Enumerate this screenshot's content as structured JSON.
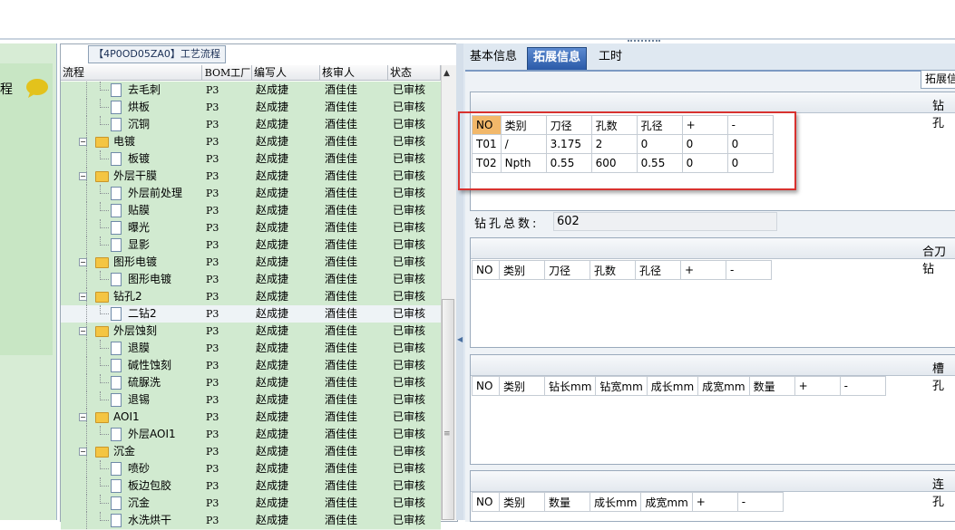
{
  "left_sidebar": {
    "partial_label": "程"
  },
  "process_panel": {
    "title": "【4P0OD05ZA0】工艺流程",
    "columns": [
      "流程",
      "BOM工厂",
      "编写人",
      "核审人",
      "状态"
    ],
    "rows": [
      {
        "name": "去毛刺",
        "type": "step",
        "bom": "P3",
        "writer": "赵成捷",
        "reviewer": "酒佳佳",
        "status": "已审核"
      },
      {
        "name": "烘板",
        "type": "step",
        "bom": "P3",
        "writer": "赵成捷",
        "reviewer": "酒佳佳",
        "status": "已审核"
      },
      {
        "name": "沉铜",
        "type": "step",
        "bom": "P3",
        "writer": "赵成捷",
        "reviewer": "酒佳佳",
        "status": "已审核"
      },
      {
        "name": "电镀",
        "type": "group",
        "bom": "P3",
        "writer": "赵成捷",
        "reviewer": "酒佳佳",
        "status": "已审核"
      },
      {
        "name": "板镀",
        "type": "step",
        "bom": "P3",
        "writer": "赵成捷",
        "reviewer": "酒佳佳",
        "status": "已审核"
      },
      {
        "name": "外层干膜",
        "type": "group",
        "bom": "P3",
        "writer": "赵成捷",
        "reviewer": "酒佳佳",
        "status": "已审核"
      },
      {
        "name": "外层前处理",
        "type": "step",
        "bom": "P3",
        "writer": "赵成捷",
        "reviewer": "酒佳佳",
        "status": "已审核"
      },
      {
        "name": "贴膜",
        "type": "step",
        "bom": "P3",
        "writer": "赵成捷",
        "reviewer": "酒佳佳",
        "status": "已审核"
      },
      {
        "name": "曝光",
        "type": "step",
        "bom": "P3",
        "writer": "赵成捷",
        "reviewer": "酒佳佳",
        "status": "已审核"
      },
      {
        "name": "显影",
        "type": "step",
        "bom": "P3",
        "writer": "赵成捷",
        "reviewer": "酒佳佳",
        "status": "已审核"
      },
      {
        "name": "图形电镀",
        "type": "group",
        "bom": "P3",
        "writer": "赵成捷",
        "reviewer": "酒佳佳",
        "status": "已审核"
      },
      {
        "name": "图形电镀",
        "type": "step",
        "bom": "P3",
        "writer": "赵成捷",
        "reviewer": "酒佳佳",
        "status": "已审核"
      },
      {
        "name": "钻孔2",
        "type": "group",
        "bom": "P3",
        "writer": "赵成捷",
        "reviewer": "酒佳佳",
        "status": "已审核"
      },
      {
        "name": "二钻2",
        "type": "step",
        "bom": "P3",
        "writer": "赵成捷",
        "reviewer": "酒佳佳",
        "status": "已审核",
        "selected": true
      },
      {
        "name": "外层蚀刻",
        "type": "group",
        "bom": "P3",
        "writer": "赵成捷",
        "reviewer": "酒佳佳",
        "status": "已审核"
      },
      {
        "name": "退膜",
        "type": "step",
        "bom": "P3",
        "writer": "赵成捷",
        "reviewer": "酒佳佳",
        "status": "已审核"
      },
      {
        "name": "碱性蚀刻",
        "type": "step",
        "bom": "P3",
        "writer": "赵成捷",
        "reviewer": "酒佳佳",
        "status": "已审核"
      },
      {
        "name": "硫脲洗",
        "type": "step",
        "bom": "P3",
        "writer": "赵成捷",
        "reviewer": "酒佳佳",
        "status": "已审核"
      },
      {
        "name": "退锡",
        "type": "step",
        "bom": "P3",
        "writer": "赵成捷",
        "reviewer": "酒佳佳",
        "status": "已审核"
      },
      {
        "name": "AOI1",
        "type": "group",
        "bom": "P3",
        "writer": "赵成捷",
        "reviewer": "酒佳佳",
        "status": "已审核"
      },
      {
        "name": "外层AOI1",
        "type": "step",
        "bom": "P3",
        "writer": "赵成捷",
        "reviewer": "酒佳佳",
        "status": "已审核"
      },
      {
        "name": "沉金",
        "type": "group",
        "bom": "P3",
        "writer": "赵成捷",
        "reviewer": "酒佳佳",
        "status": "已审核"
      },
      {
        "name": "喷砂",
        "type": "step",
        "bom": "P3",
        "writer": "赵成捷",
        "reviewer": "酒佳佳",
        "status": "已审核"
      },
      {
        "name": "板边包胶",
        "type": "step",
        "bom": "P3",
        "writer": "赵成捷",
        "reviewer": "酒佳佳",
        "status": "已审核"
      },
      {
        "name": "沉金",
        "type": "step",
        "bom": "P3",
        "writer": "赵成捷",
        "reviewer": "酒佳佳",
        "status": "已审核"
      },
      {
        "name": "水洗烘干",
        "type": "step",
        "bom": "P3",
        "writer": "赵成捷",
        "reviewer": "酒佳佳",
        "status": "已审核"
      }
    ]
  },
  "detail_panel": {
    "tabs": [
      "基本信息",
      "拓展信息",
      "工时"
    ],
    "active_tab": "拓展信息",
    "sub_tab": "拓展信",
    "drill": {
      "title": "钻孔",
      "columns": [
        "NO",
        "类别",
        "刀径",
        "孔数",
        "孔径",
        "+",
        "-"
      ],
      "rows": [
        [
          "T01",
          "/",
          "3.175",
          "2",
          "0",
          "0",
          "0"
        ],
        [
          "T02",
          "Npth",
          "0.55",
          "600",
          "0.55",
          "0",
          "0"
        ]
      ],
      "total_label": "钻孔总数:",
      "total_value": "602"
    },
    "combined_drill": {
      "title": "合刀钻",
      "columns": [
        "NO",
        "类别",
        "刀径",
        "孔数",
        "孔径",
        "+",
        "-"
      ]
    },
    "slot_hole": {
      "title": "槽孔",
      "columns": [
        "NO",
        "类别",
        "钻长mm",
        "钻宽mm",
        "成长mm",
        "成宽mm",
        "数量",
        "+",
        "-"
      ]
    },
    "linked_hole": {
      "title": "连孔",
      "columns": [
        "NO",
        "类别",
        "数量",
        "成长mm",
        "成宽mm",
        "+",
        "-"
      ]
    }
  },
  "colors": {
    "row_green": "#d1ead0",
    "tab_active": "#2b5aa8",
    "highlight_red": "#d8322f"
  }
}
